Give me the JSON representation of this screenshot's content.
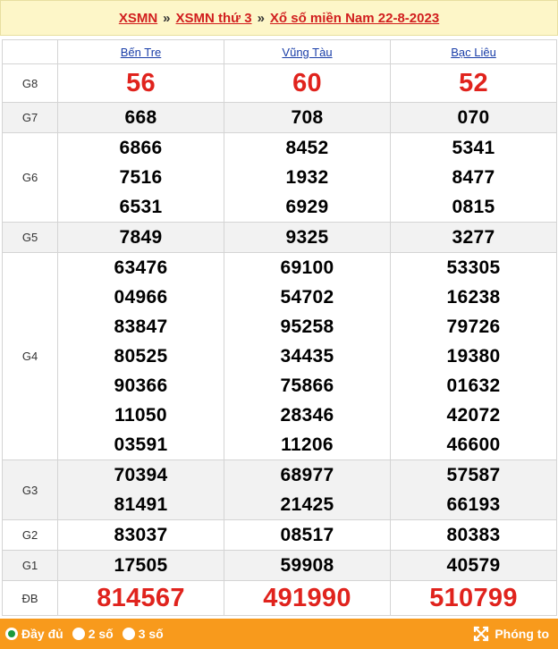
{
  "breadcrumb": {
    "items": [
      "XSMN",
      "XSMN thứ 3",
      "Xổ số miền Nam 22-8-2023"
    ],
    "separator": "»"
  },
  "table": {
    "provinces": [
      "Bến Tre",
      "Vũng Tàu",
      "Bạc Liêu"
    ],
    "prizes": [
      {
        "label": "G8",
        "values": [
          [
            "56"
          ],
          [
            "60"
          ],
          [
            "52"
          ]
        ]
      },
      {
        "label": "G7",
        "values": [
          [
            "668"
          ],
          [
            "708"
          ],
          [
            "070"
          ]
        ]
      },
      {
        "label": "G6",
        "values": [
          [
            "6866",
            "7516",
            "6531"
          ],
          [
            "8452",
            "1932",
            "6929"
          ],
          [
            "5341",
            "8477",
            "0815"
          ]
        ]
      },
      {
        "label": "G5",
        "values": [
          [
            "7849"
          ],
          [
            "9325"
          ],
          [
            "3277"
          ]
        ]
      },
      {
        "label": "G4",
        "values": [
          [
            "63476",
            "04966",
            "83847",
            "80525",
            "90366",
            "11050",
            "03591"
          ],
          [
            "69100",
            "54702",
            "95258",
            "34435",
            "75866",
            "28346",
            "11206"
          ],
          [
            "53305",
            "16238",
            "79726",
            "19380",
            "01632",
            "42072",
            "46600"
          ]
        ]
      },
      {
        "label": "G3",
        "values": [
          [
            "70394",
            "81491"
          ],
          [
            "68977",
            "21425"
          ],
          [
            "57587",
            "66193"
          ]
        ]
      },
      {
        "label": "G2",
        "values": [
          [
            "83037"
          ],
          [
            "08517"
          ],
          [
            "80383"
          ]
        ]
      },
      {
        "label": "G1",
        "values": [
          [
            "17505"
          ],
          [
            "59908"
          ],
          [
            "40579"
          ]
        ]
      },
      {
        "label": "ĐB",
        "values": [
          [
            "814567"
          ],
          [
            "491990"
          ],
          [
            "510799"
          ]
        ]
      }
    ]
  },
  "footer": {
    "options": [
      {
        "label": "Đầy đủ",
        "checked": true
      },
      {
        "label": "2 số",
        "checked": false
      },
      {
        "label": "3 số",
        "checked": false
      }
    ],
    "zoom_label": "Phóng to",
    "zoom_icon": "expand-arrows-icon"
  },
  "colors": {
    "header_bg": "#fdf6c8",
    "link_red": "#d11e1e",
    "province_link": "#1a3ea8",
    "prize_red": "#e0231d",
    "footer_bg": "#f89a1c",
    "radio_checked": "#1c9a3c"
  }
}
